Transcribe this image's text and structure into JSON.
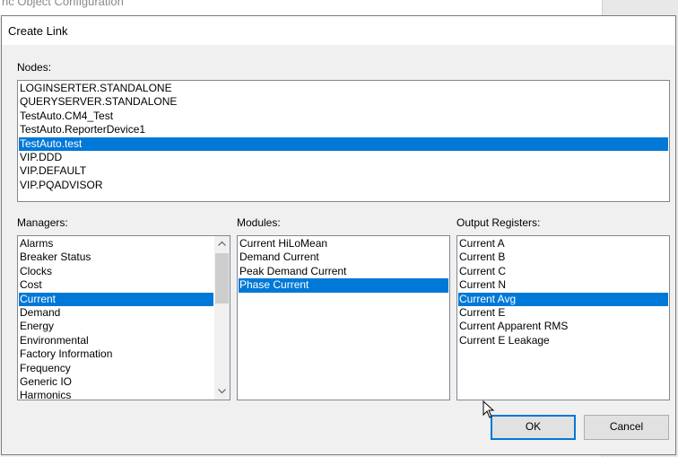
{
  "background_window": {
    "title": "nc Object Configuration"
  },
  "dialog": {
    "title": "Create Link"
  },
  "nodes": {
    "label": "Nodes:",
    "items": [
      {
        "label": "LOGINSERTER.STANDALONE",
        "selected": false
      },
      {
        "label": "QUERYSERVER.STANDALONE",
        "selected": false
      },
      {
        "label": "TestAuto.CM4_Test",
        "selected": false
      },
      {
        "label": "TestAuto.ReporterDevice1",
        "selected": false
      },
      {
        "label": "TestAuto.test",
        "selected": true
      },
      {
        "label": "VIP.DDD",
        "selected": false
      },
      {
        "label": "VIP.DEFAULT",
        "selected": false
      },
      {
        "label": "VIP.PQADVISOR",
        "selected": false
      }
    ]
  },
  "managers": {
    "label": "Managers:",
    "items": [
      {
        "label": "Alarms",
        "selected": false
      },
      {
        "label": "Breaker Status",
        "selected": false
      },
      {
        "label": "Clocks",
        "selected": false
      },
      {
        "label": "Cost",
        "selected": false
      },
      {
        "label": "Current",
        "selected": true
      },
      {
        "label": "Demand",
        "selected": false
      },
      {
        "label": "Energy",
        "selected": false
      },
      {
        "label": "Environmental",
        "selected": false
      },
      {
        "label": "Factory Information",
        "selected": false
      },
      {
        "label": "Frequency",
        "selected": false
      },
      {
        "label": "Generic IO",
        "selected": false
      },
      {
        "label": "Harmonics",
        "selected": false
      }
    ]
  },
  "modules": {
    "label": "Modules:",
    "items": [
      {
        "label": "Current HiLoMean",
        "selected": false
      },
      {
        "label": "Demand Current",
        "selected": false
      },
      {
        "label": "Peak Demand Current",
        "selected": false
      },
      {
        "label": "Phase Current",
        "selected": true
      }
    ]
  },
  "output_registers": {
    "label": "Output Registers:",
    "items": [
      {
        "label": "Current A",
        "selected": false
      },
      {
        "label": "Current B",
        "selected": false
      },
      {
        "label": "Current C",
        "selected": false
      },
      {
        "label": "Current N",
        "selected": false
      },
      {
        "label": "Current Avg",
        "selected": true
      },
      {
        "label": "Current E",
        "selected": false
      },
      {
        "label": "Current Apparent RMS",
        "selected": false
      },
      {
        "label": "Current E Leakage",
        "selected": false
      }
    ]
  },
  "buttons": {
    "ok": "OK",
    "cancel": "Cancel"
  },
  "icons": {
    "scroll_up": "chevron-up-icon",
    "scroll_down": "chevron-down-icon",
    "cursor": "mouse-pointer-icon"
  },
  "colors": {
    "selection": "#0078d7",
    "default_button_border": "#0078d7"
  }
}
